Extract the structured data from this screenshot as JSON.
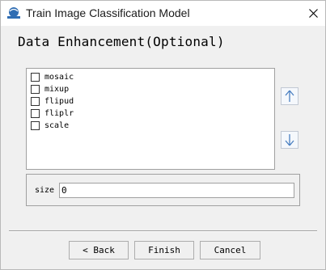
{
  "window": {
    "title": "Train Image Classification Model",
    "app_icon": "app-logo-icon",
    "close_icon": "close-icon"
  },
  "page": {
    "heading": "Data Enhancement(Optional)"
  },
  "augmentations": [
    {
      "label": "mosaic",
      "checked": false
    },
    {
      "label": "mixup",
      "checked": false
    },
    {
      "label": "flipud",
      "checked": false
    },
    {
      "label": "fliplr",
      "checked": false
    },
    {
      "label": "scale",
      "checked": false
    }
  ],
  "reorder": {
    "up_icon": "arrow-up-icon",
    "down_icon": "arrow-down-icon"
  },
  "size": {
    "label": "size",
    "value": "0"
  },
  "footer": {
    "back_label": "< Back",
    "finish_label": "Finish",
    "cancel_label": "Cancel"
  },
  "colors": {
    "arrow_accent": "#4a7fc1",
    "window_bg": "#f0f0f0"
  }
}
